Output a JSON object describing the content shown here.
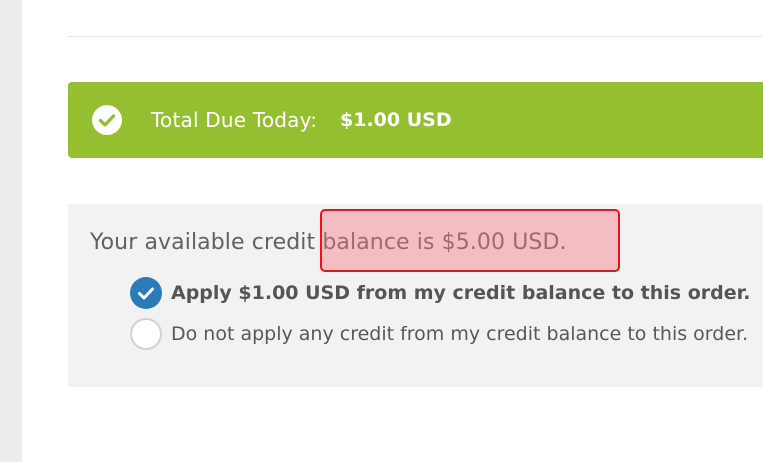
{
  "total_due": {
    "label": "Total Due Today:",
    "amount": "$1.00 USD",
    "icon": "check-circle-icon",
    "color": "#93bf30"
  },
  "credit": {
    "message": "Your available credit balance is $5.00 USD.",
    "options": [
      {
        "label": "Apply $1.00 USD from my credit balance to this order.",
        "selected": true
      },
      {
        "label": "Do not apply any credit from my credit balance to this order.",
        "selected": false
      }
    ],
    "accent_color": "#2b7bb8",
    "highlight_color": "#e8141e"
  }
}
